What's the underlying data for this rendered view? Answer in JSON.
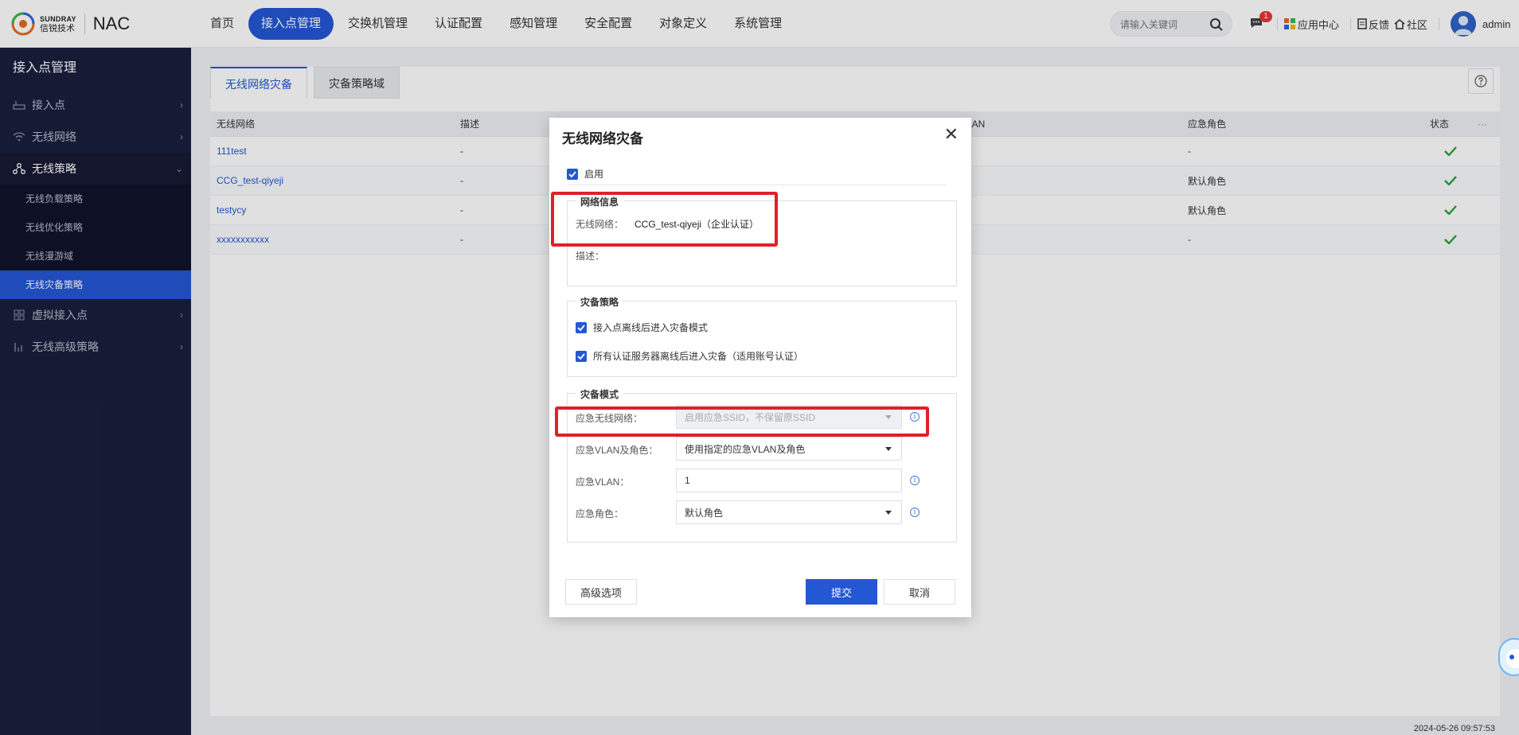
{
  "brand": {
    "en": "SUNDRAY",
    "cn": "信锐技术",
    "product": "NAC"
  },
  "nav": [
    {
      "label": "首页",
      "active": false
    },
    {
      "label": "接入点管理",
      "active": true
    },
    {
      "label": "交换机管理",
      "active": false
    },
    {
      "label": "认证配置",
      "active": false
    },
    {
      "label": "感知管理",
      "active": false
    },
    {
      "label": "安全配置",
      "active": false
    },
    {
      "label": "对象定义",
      "active": false
    },
    {
      "label": "系统管理",
      "active": false
    }
  ],
  "search": {
    "placeholder": "请输入关键词"
  },
  "topbar": {
    "badge": "1",
    "apps": "应用中心",
    "feedback": "反馈",
    "community": "社区",
    "user": "admin"
  },
  "sidebar": {
    "title": "接入点管理",
    "items": [
      {
        "label": "接入点",
        "icon": "router-icon"
      },
      {
        "label": "无线网络",
        "icon": "wifi-icon"
      },
      {
        "label": "无线策略",
        "icon": "share-icon"
      },
      {
        "label": "虚拟接入点",
        "icon": "grid-icon"
      },
      {
        "label": "无线高级策略",
        "icon": "chart-icon"
      }
    ],
    "subitems": [
      "无线负载策略",
      "无线优化策略",
      "无线漫游域",
      "无线灾备策略"
    ]
  },
  "tabs": [
    "无线网络灾备",
    "灾备策略域"
  ],
  "table": {
    "headers": [
      "无线网络",
      "描述",
      "LAN",
      "应急角色",
      "状态",
      "···"
    ],
    "rows": [
      {
        "network": "111test",
        "desc": "-",
        "role": "-"
      },
      {
        "network": "CCG_test-qiyeji",
        "desc": "-",
        "role": "默认角色"
      },
      {
        "network": "testycy",
        "desc": "-",
        "role": "默认角色"
      },
      {
        "network": "xxxxxxxxxxx",
        "desc": "-",
        "role": "-"
      }
    ]
  },
  "dialog": {
    "title": "无线网络灾备",
    "enable_label": "启用",
    "net_info": {
      "legend": "网络信息",
      "network_label": "无线网络：",
      "network_value": "CCG_test-qiyeji（企业认证）",
      "desc_label": "描述："
    },
    "policy": {
      "legend": "灾备策略",
      "opt1": "接入点离线后进入灾备模式",
      "opt2": "所有认证服务器离线后进入灾备（适用账号认证）"
    },
    "mode": {
      "legend": "灾备模式",
      "emergency_net_label": "应急无线网络：",
      "emergency_net_value": "启用应急SSID，不保留原SSID",
      "vlan_role_label": "应急VLAN及角色：",
      "vlan_role_value": "使用指定的应急VLAN及角色",
      "vlan_label": "应急VLAN：",
      "vlan_value": "1",
      "role_label": "应急角色：",
      "role_value": "默认角色"
    },
    "advanced": "高级选项",
    "submit": "提交",
    "cancel": "取消"
  },
  "footer": {
    "time": "2024-05-26 09:57:53"
  },
  "colors": {
    "primary": "#2457d4",
    "sidebar": "#1a1f3d",
    "highlight": "#e0202a",
    "ok": "#27a33a"
  }
}
